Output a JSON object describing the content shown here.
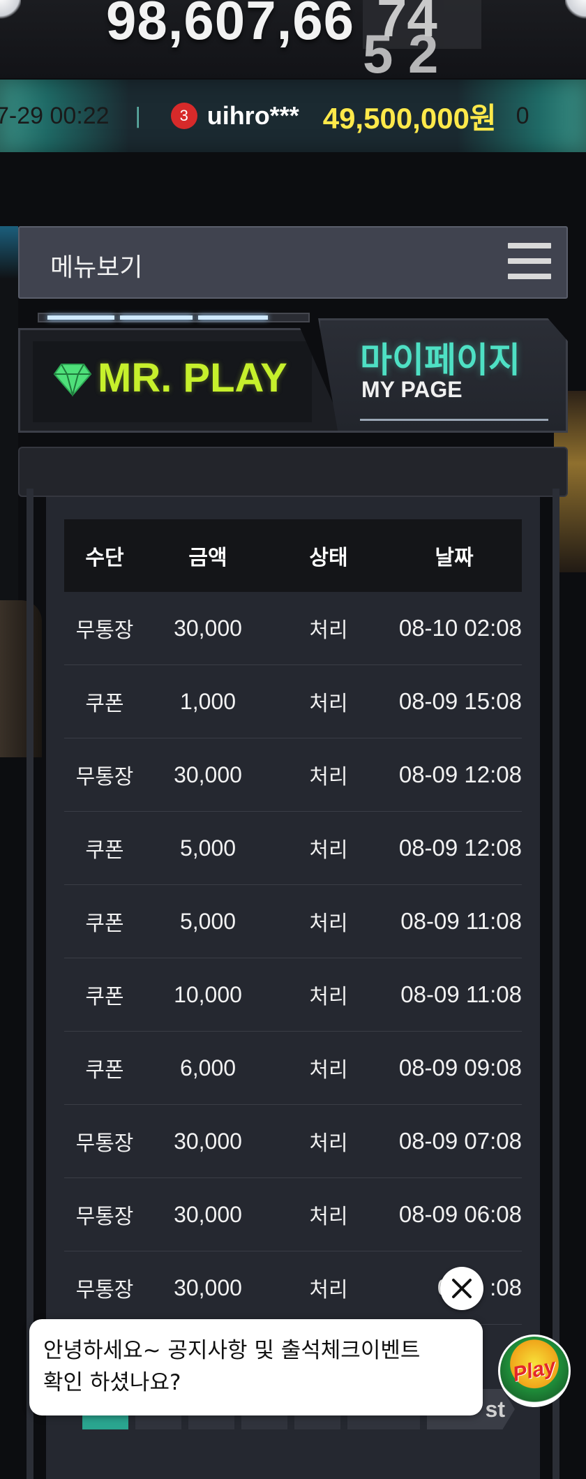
{
  "jackpot": {
    "display_main": "98,607,66",
    "display_rolling_top": "74",
    "display_rolling_bottom": "5 2"
  },
  "ticker": {
    "date": "7-29 00:22",
    "separator": "|",
    "rank": "3",
    "user": "uihro***",
    "amount": "49,500,000원",
    "next_fragment": "0"
  },
  "menu": {
    "label": "메뉴보기",
    "icon": "hamburger-icon"
  },
  "sign": {
    "brand": "MR. PLAY",
    "brand_icon": "diamond-icon",
    "page_title_kr": "마이페이지",
    "page_title_en": "MY PAGE"
  },
  "table": {
    "headers": {
      "method": "수단",
      "amount": "금액",
      "status": "상태",
      "date": "날짜"
    },
    "rows": [
      {
        "method": "무통장",
        "amount": "30,000",
        "status": "처리",
        "date": "08-10 02:08"
      },
      {
        "method": "쿠폰",
        "amount": "1,000",
        "status": "처리",
        "date": "08-09 15:08"
      },
      {
        "method": "무통장",
        "amount": "30,000",
        "status": "처리",
        "date": "08-09 12:08"
      },
      {
        "method": "쿠폰",
        "amount": "5,000",
        "status": "처리",
        "date": "08-09 12:08"
      },
      {
        "method": "쿠폰",
        "amount": "5,000",
        "status": "처리",
        "date": "08-09 11:08"
      },
      {
        "method": "쿠폰",
        "amount": "10,000",
        "status": "처리",
        "date": "08-09 11:08"
      },
      {
        "method": "쿠폰",
        "amount": "6,000",
        "status": "처리",
        "date": "08-09 09:08"
      },
      {
        "method": "무통장",
        "amount": "30,000",
        "status": "처리",
        "date": "08-09 07:08"
      },
      {
        "method": "무통장",
        "amount": "30,000",
        "status": "처리",
        "date": "08-09 06:08"
      },
      {
        "method": "무통장",
        "amount": "30,000",
        "status": "처리",
        "date": "08-0 :08"
      }
    ]
  },
  "pagination": {
    "last_label": "st"
  },
  "chat": {
    "line1": "안녕하세요~ 공지사항 및 출석체크이벤트",
    "line2": "확인 하셨나요?",
    "close_icon": "close-icon",
    "avatar_text": "Play"
  },
  "colors": {
    "accent_green": "#c6f02c",
    "accent_teal": "#4ee0c4",
    "ticker_amount": "#ffe94a",
    "rank_badge": "#d72a2a",
    "active_page": "#2aa58f"
  }
}
